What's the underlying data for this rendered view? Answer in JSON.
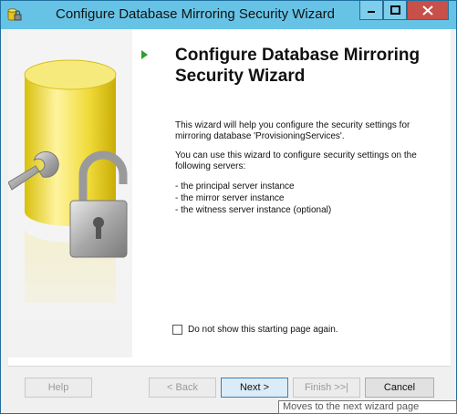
{
  "window": {
    "title": "Configure Database Mirroring Security Wizard"
  },
  "main": {
    "heading": "Configure Database Mirroring Security Wizard",
    "paragraph1": "This wizard will help you configure the security settings for mirroring database 'ProvisioningServices'.",
    "paragraph2": "You can use this wizard to configure security settings on the following servers:",
    "servers": [
      "- the principal server instance",
      "- the mirror server instance",
      "- the witness server instance (optional)"
    ],
    "checkbox_label": "Do not show this starting page again.",
    "checkbox_checked": false
  },
  "buttons": {
    "help": "Help",
    "back": "< Back",
    "next": "Next >",
    "finish": "Finish >>|",
    "cancel": "Cancel"
  },
  "tooltip": "Moves to the next wizard page",
  "colors": {
    "titlebar": "#66c3e6",
    "close_button": "#c7504a",
    "arrow": "#2aa02a",
    "cylinder": "#f4e15a"
  },
  "icons": {
    "app": "database-icon",
    "arrow": "play-arrow-icon",
    "illustration": "database-wrench-lock-illustration"
  }
}
